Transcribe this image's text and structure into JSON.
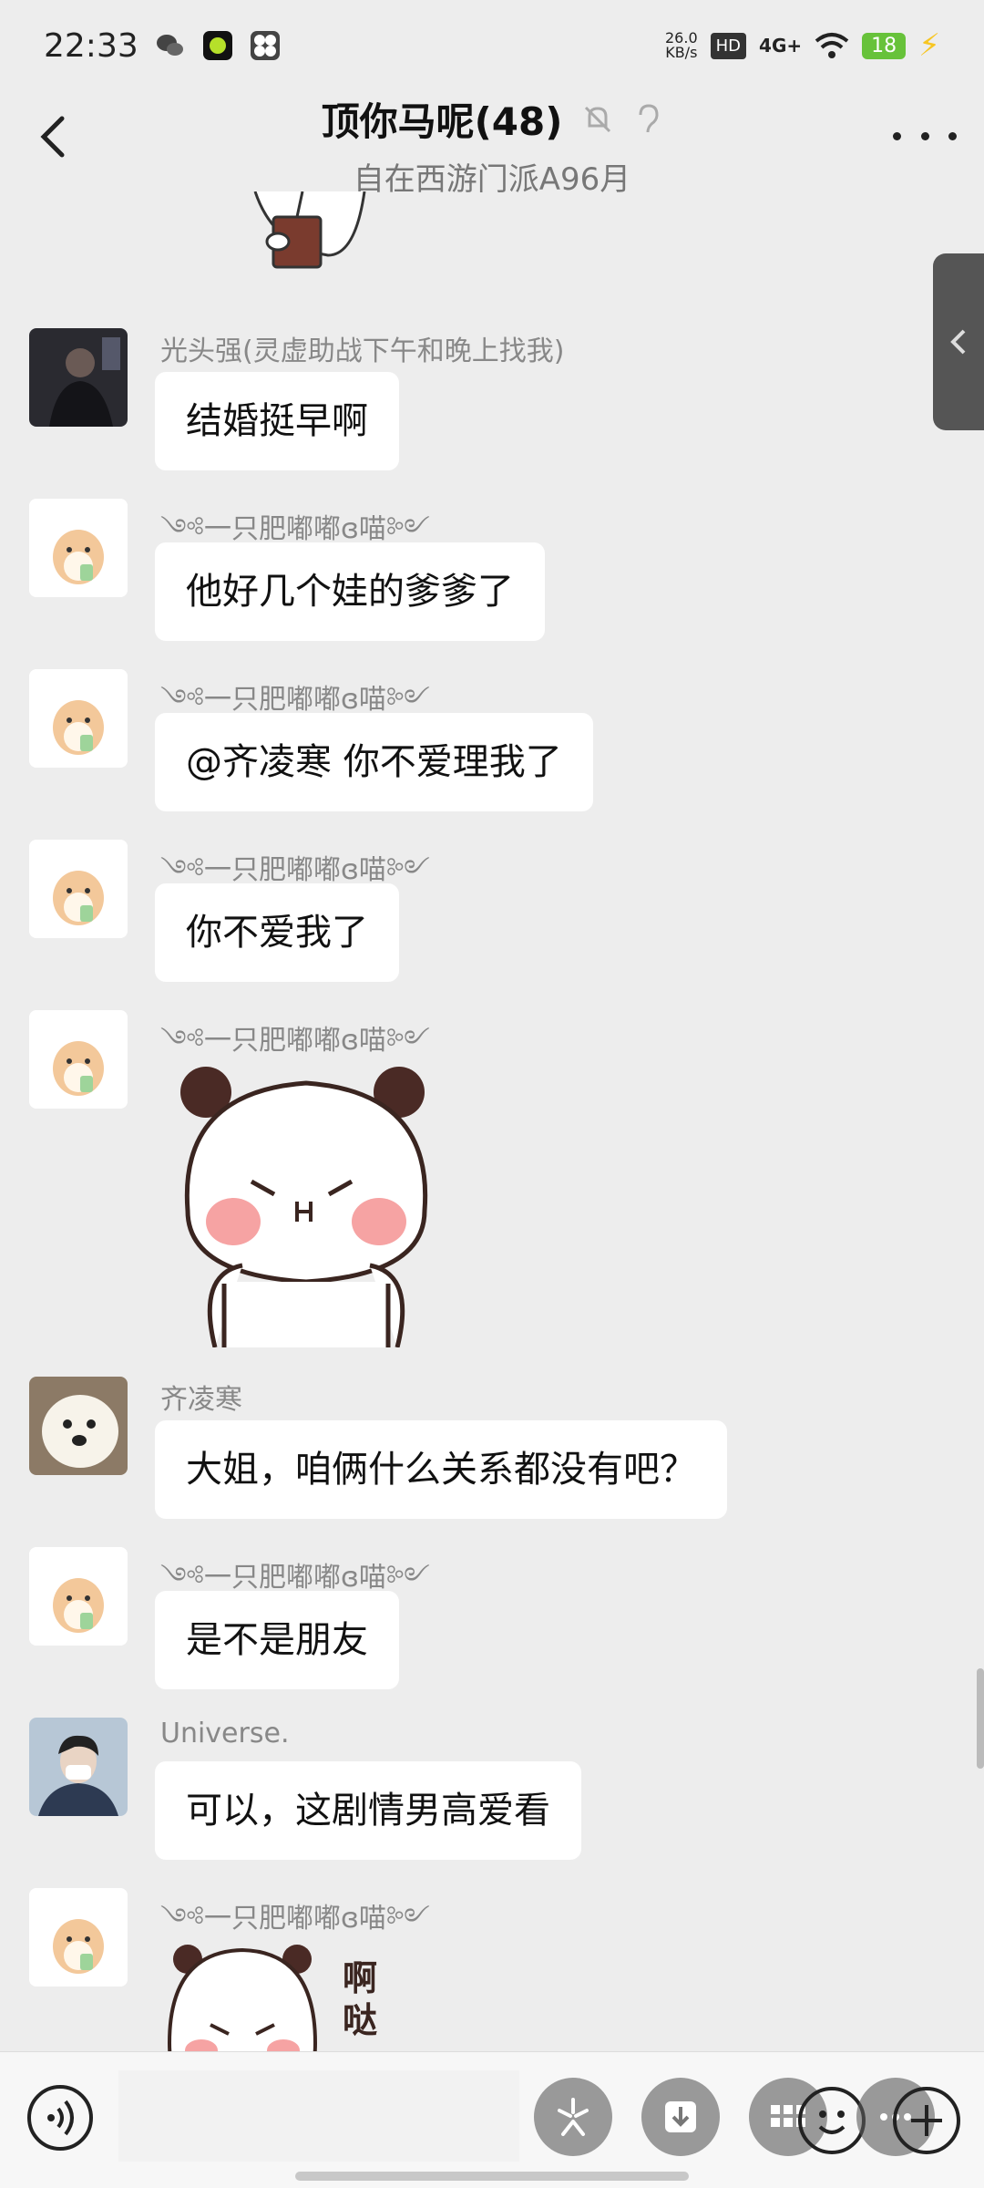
{
  "status_bar": {
    "time": "22:33",
    "net_speed_value": "26.0",
    "net_speed_unit": "KB/s",
    "hd": "HD",
    "network": "4G+",
    "battery": "18"
  },
  "header": {
    "title": "顶你马呢(48)",
    "subtitle": "自在西游门派A96月"
  },
  "messages": [
    {
      "sender": "光头强(灵虚助战下午和晚上找我)",
      "text": "结婚挺早啊"
    },
    {
      "sender": "༺一只肥嘟嘟ɞ喵༻",
      "text": "他好几个娃的爹爹了"
    },
    {
      "sender": "༺一只肥嘟嘟ɞ喵༻",
      "text": "@齐凌寒  你不爱理我了"
    },
    {
      "sender": "༺一只肥嘟嘟ɞ喵༻",
      "text": "你不爱我了"
    },
    {
      "sender": "༺一只肥嘟嘟ɞ喵༻",
      "sticker": "panda-pouting-sticker"
    },
    {
      "sender": "齐凌寒",
      "text": "大姐，咱俩什么关系都没有吧？"
    },
    {
      "sender": "༺一只肥嘟嘟ɞ喵༻",
      "text": "是不是朋友"
    },
    {
      "sender": "Universe.",
      "text": "可以，这剧情男高爱看"
    },
    {
      "sender": "༺一只肥嘟嘟ɞ喵༻",
      "sticker": "panda-sticker",
      "sticker_text": "啊哒"
    }
  ],
  "icons": {
    "back": "chevron-left-icon",
    "mute": "bell-off-icon",
    "ear": "ear-icon",
    "more": "more-dots-icon",
    "voice": "voice-icon",
    "emoji": "emoji-icon",
    "plus": "plus-icon"
  },
  "colors": {
    "background": "#ededed",
    "bubble": "#ffffff",
    "battery": "#67c23a"
  }
}
